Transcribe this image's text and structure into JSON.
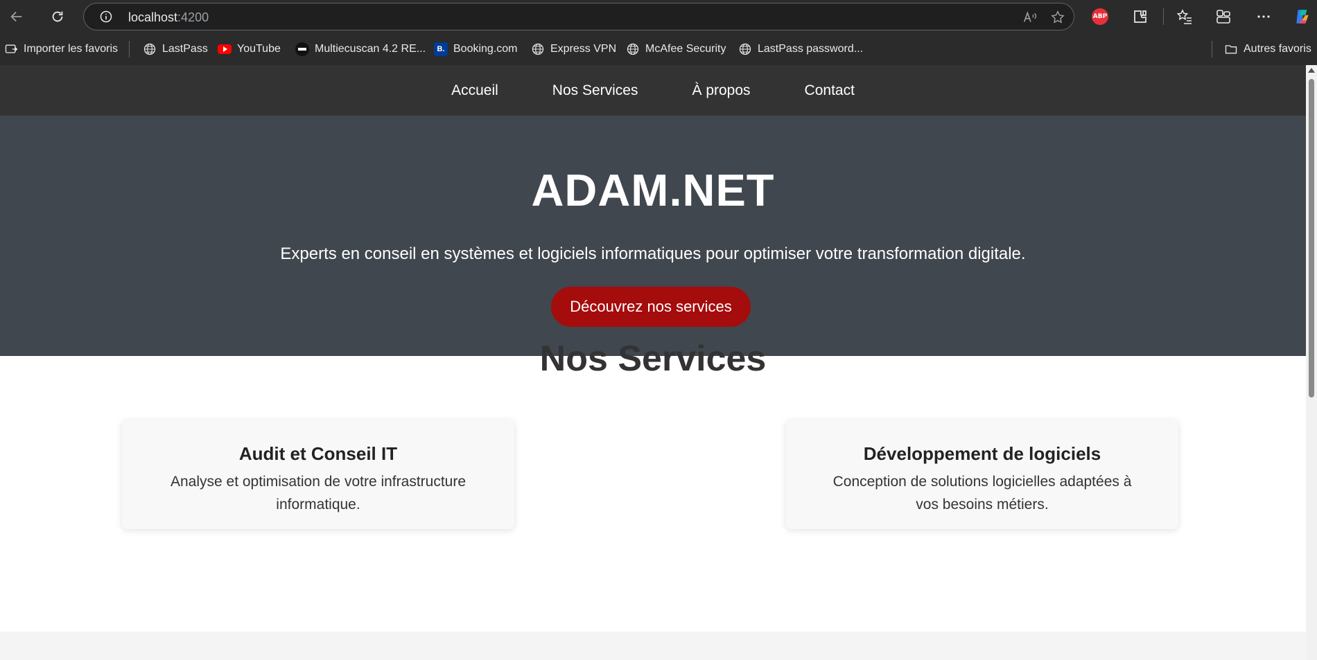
{
  "browser": {
    "url_host": "localhost",
    "url_port": ":4200",
    "icons": [
      "back-arrow-icon",
      "refresh-icon",
      "site-info-icon",
      "read-aloud-icon",
      "star-icon",
      "adblock-plus-icon",
      "extensions-icon",
      "favorites-icon",
      "collections-icon",
      "more-icon",
      "copilot-icon"
    ],
    "adblock_label": "ABP"
  },
  "bookmarks": {
    "items": [
      {
        "label": "Importer les favoris",
        "icon": "import-favorites-icon"
      },
      {
        "label": "LastPass",
        "icon": "globe-icon"
      },
      {
        "label": "YouTube",
        "icon": "youtube-icon"
      },
      {
        "label": "Multiecuscan 4.2 RE...",
        "icon": "multiecuscan-icon"
      },
      {
        "label": "Booking.com",
        "icon": "booking-icon",
        "badge": "B."
      },
      {
        "label": "Express VPN",
        "icon": "globe-icon"
      },
      {
        "label": "McAfee Security",
        "icon": "globe-icon"
      },
      {
        "label": "LastPass password...",
        "icon": "globe-icon"
      }
    ],
    "other_favorites": "Autres favoris"
  },
  "site": {
    "nav": [
      "Accueil",
      "Nos Services",
      "À propos",
      "Contact"
    ],
    "hero": {
      "title": "ADAM.NET",
      "subtitle": "Experts en conseil en systèmes et logiciels informatiques pour optimiser votre transformation digitale.",
      "cta": "Découvrez nos services"
    },
    "services": {
      "heading": "Nos Services",
      "cards": [
        {
          "title": "Audit et Conseil IT",
          "text": "Analyse et optimisation de votre infrastructure informatique."
        },
        {
          "title": "Développement de logiciels",
          "text": "Conception de solutions logicielles adaptées à vos besoins métiers."
        }
      ]
    }
  },
  "colors": {
    "nav_bg": "#333333",
    "hero_bg": "#41474e",
    "cta_bg": "#a50c0c",
    "card_bg": "#f8f8f8"
  }
}
